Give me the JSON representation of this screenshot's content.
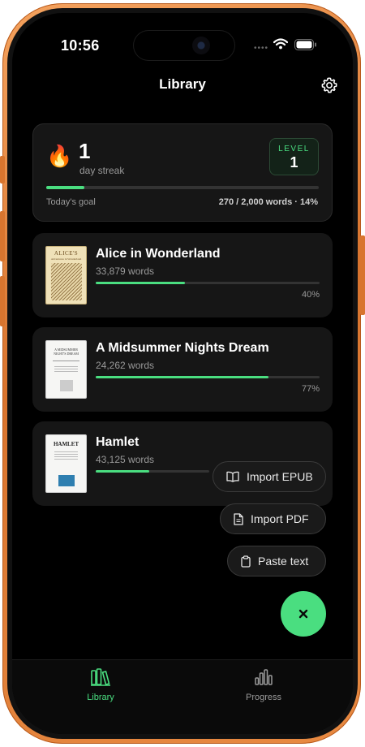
{
  "status": {
    "time": "10:56"
  },
  "header": {
    "title": "Library"
  },
  "streak": {
    "count": "1",
    "label": "day streak",
    "level_label": "LEVEL",
    "level": "1",
    "goal_label": "Today's goal",
    "goal_value": "270 / 2,000 words · 14%",
    "goal_fraction": 0.14
  },
  "books": [
    {
      "title": "Alice in Wonderland",
      "words": "33,879 words",
      "percent": "40%",
      "progress": 0.4
    },
    {
      "title": "A Midsummer Nights Dream",
      "words": "24,262 words",
      "percent": "77%",
      "progress": 0.77
    },
    {
      "title": "Hamlet",
      "words": "43,125 words",
      "progress": 0.24
    }
  ],
  "covers": {
    "alice_title": "ALICE'S",
    "alice_subtitle": "Adventures in Wonderland",
    "dream_title": "A MIDSUMMER NIGHT'S DREAM",
    "hamlet_title": "HAMLET"
  },
  "fab_menu": {
    "import_epub": "Import EPUB",
    "import_pdf": "Import PDF",
    "paste_text": "Paste text"
  },
  "tabs": [
    {
      "label": "Library",
      "active": true
    },
    {
      "label": "Progress",
      "active": false
    }
  ],
  "colors": {
    "accent": "#4ade80",
    "background": "#000000",
    "card": "#161616",
    "frame": "#e0803a"
  }
}
